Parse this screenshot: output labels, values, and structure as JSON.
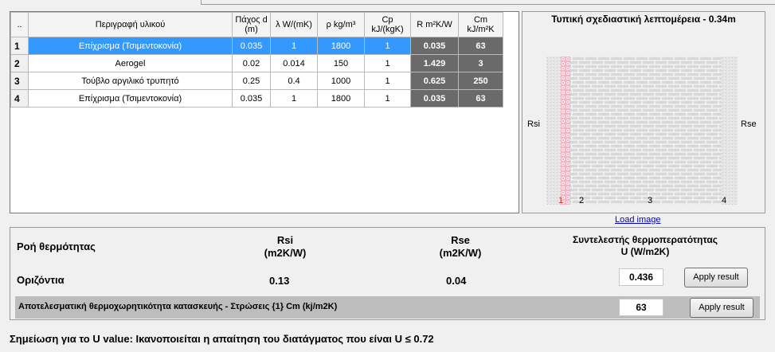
{
  "grid": {
    "headers": [
      "..",
      "Περιγραφή υλικού",
      "Πάχος d\n(m)",
      "λ W/(mK)",
      "ρ kg/m³",
      "Cp\nkJ/(kgK)",
      "R m²K/W",
      "Cm\nkJ/m²K"
    ],
    "rows": [
      {
        "num": "1",
        "desc": "Επίχρισμα (Τσιμεντοκονία)",
        "d": "0.035",
        "lambda": "1",
        "rho": "1800",
        "cp": "1",
        "r": "0.035",
        "cm": "63"
      },
      {
        "num": "2",
        "desc": "Aerogel",
        "d": "0.02",
        "lambda": "0.014",
        "rho": "150",
        "cp": "1",
        "r": "1.429",
        "cm": "3"
      },
      {
        "num": "3",
        "desc": "Τούβλο αργιλικό τρυπητό",
        "d": "0.25",
        "lambda": "0.4",
        "rho": "1000",
        "cp": "1",
        "r": "0.625",
        "cm": "250"
      },
      {
        "num": "4",
        "desc": "Επίχρισμα (Τσιμεντοκονία)",
        "d": "0.035",
        "lambda": "1",
        "rho": "1800",
        "cp": "1",
        "r": "0.035",
        "cm": "63"
      }
    ]
  },
  "detail": {
    "title": "Τυπική σχεδιαστική λεπτομέρεια - 0.34m",
    "rsi": "Rsi",
    "rse": "Rse",
    "layer_labels": [
      "1",
      "2",
      "3",
      "4"
    ],
    "load_image": "Load image"
  },
  "flow": {
    "heat_flow_label": "Ροή θερμότητας",
    "rsi_header": "Rsi\n(m2K/W)",
    "rse_header": "Rse\n(m2K/W)",
    "u_header": "Συντελεστής θερμοπερατότητας\nU (W/m2K)",
    "direction": "Οριζόντια",
    "rsi_value": "0.13",
    "rse_value": "0.04",
    "u_value": "0.436",
    "apply_label": "Apply result"
  },
  "cm": {
    "label": "Αποτελεσματική θερμοχωρητικότητα κατασκευής - Στρώσεις {1} Cm (kj/m2K)",
    "value": "63",
    "apply_label": "Apply result"
  },
  "note": "Σημείωση για το U value: Ικανοποιείται η απαίτηση του διατάγματος που είναι U ≤ 0.72",
  "colors": {
    "selected_row": "#3399ff",
    "dark_cell": "#6a6a6a",
    "aerogel": "#f4b6c4"
  }
}
